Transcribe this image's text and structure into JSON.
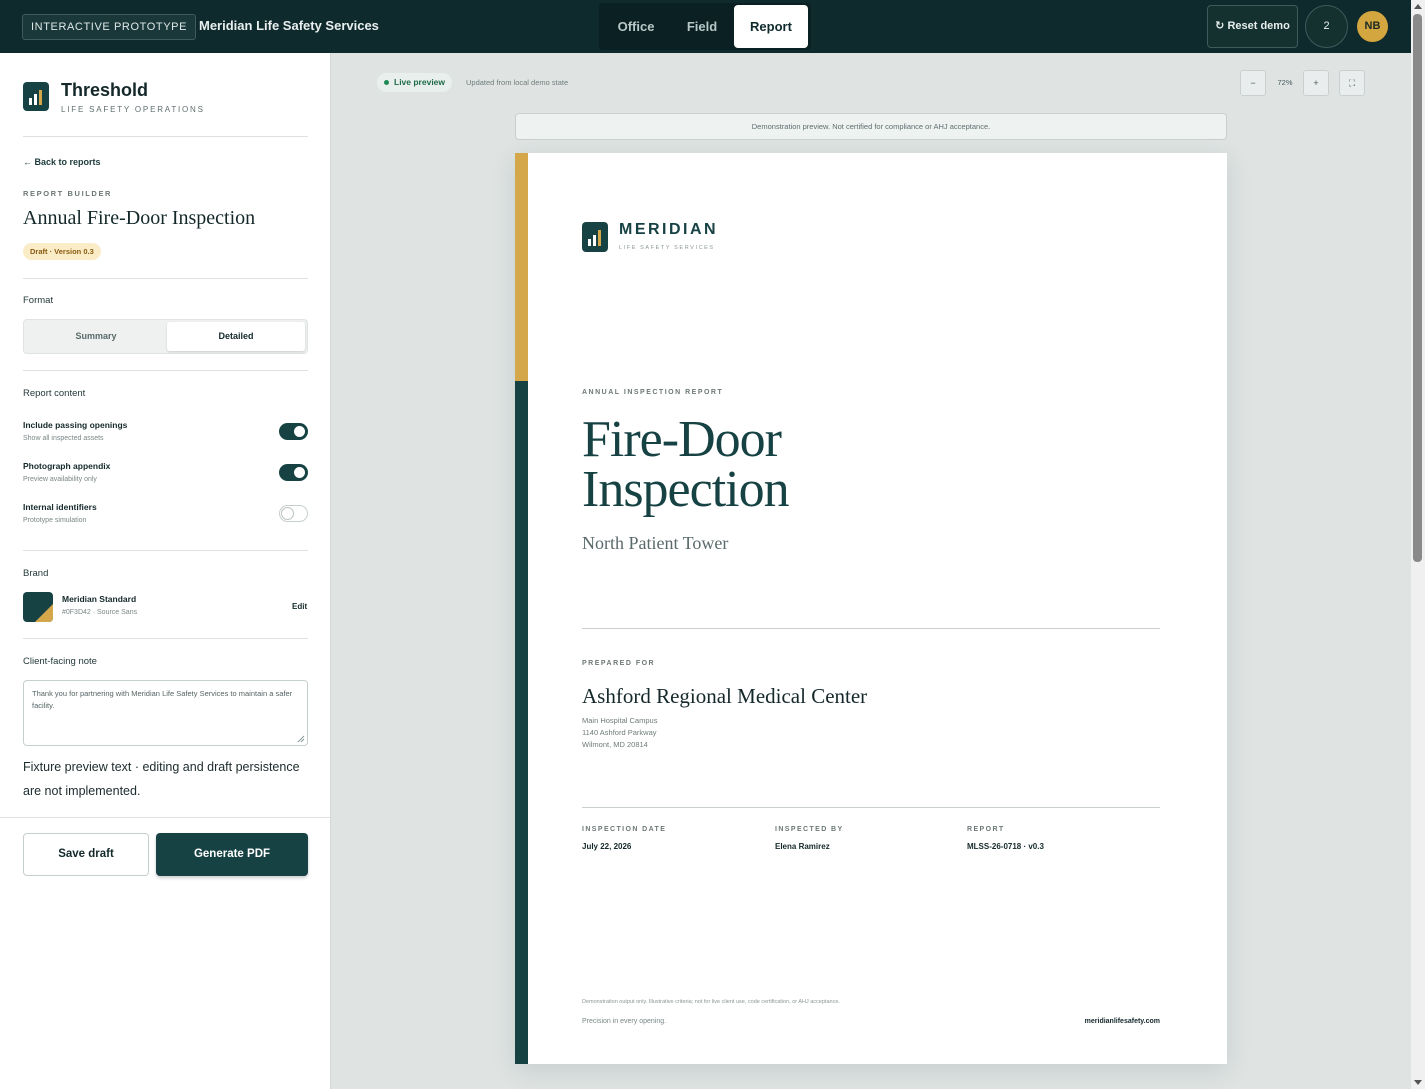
{
  "topbar": {
    "badge": "INTERACTIVE PROTOTYPE",
    "company": "Meridian Life Safety Services",
    "tabs": [
      {
        "label": "Office"
      },
      {
        "label": "Field"
      },
      {
        "label": "Report",
        "active": true
      }
    ],
    "reset_label": "↻ Reset demo",
    "count": "2",
    "avatar_initials": "NB"
  },
  "sidebar": {
    "app_name": "Threshold",
    "app_subtitle": "LIFE SAFETY OPERATIONS",
    "back_link": "← Back to reports",
    "eyebrow": "REPORT BUILDER",
    "report_title": "Annual Fire-Door Inspection",
    "status_pill": "Draft · Version 0.3",
    "format_label": "Format",
    "format_options": [
      {
        "label": "Summary",
        "active": false
      },
      {
        "label": "Detailed",
        "active": true
      }
    ],
    "content_label": "Report content",
    "toggles": [
      {
        "title": "Include passing openings",
        "desc": "Show all inspected assets",
        "on": true
      },
      {
        "title": "Photograph appendix",
        "desc": "Preview availability only",
        "on": true
      },
      {
        "title": "Internal identifiers",
        "desc": "Prototype simulation",
        "on": false
      }
    ],
    "brand_label": "Brand",
    "brand_name": "Meridian Standard",
    "brand_meta": "#0F3D42 · Source Sans",
    "edit_label": "Edit",
    "note_label": "Client-facing note",
    "note_value": "Thank you for partnering with Meridian Life Safety Services to maintain a safer facility.",
    "fixture_text": "Fixture preview text · editing and draft persistence are not implemented.",
    "save_label": "Save draft",
    "generate_label": "Generate PDF"
  },
  "preview": {
    "live_label": "Live preview",
    "updated_text": "Updated from local demo state",
    "zoom_out": "−",
    "zoom_level": "72%",
    "zoom_in": "+",
    "fullscreen_icon": "⛶",
    "disclaimer": "Demonstration preview. Not certified for compliance or AHJ acceptance."
  },
  "document": {
    "brand": "MERIDIAN",
    "brand_sub": "LIFE SAFETY SERVICES",
    "eyebrow": "ANNUAL INSPECTION REPORT",
    "title_line1": "Fire-Door",
    "title_line2": "Inspection",
    "subtitle": "North Patient Tower",
    "prepared_for_label": "PREPARED FOR",
    "client_name": "Ashford Regional Medical Center",
    "address": [
      "Main Hospital Campus",
      "1140 Ashford Parkway",
      "Wilmont, MD 20814"
    ],
    "meta": [
      {
        "label": "INSPECTION DATE",
        "value": "July 22, 2026"
      },
      {
        "label": "INSPECTED BY",
        "value": "Elena Ramirez"
      },
      {
        "label": "REPORT",
        "value": "MLSS-26-0718 · v0.3"
      }
    ],
    "fine_print": "Demonstration output only. Illustrative criteria; not for live client use, code certification, or AHJ acceptance.",
    "tagline": "Precision in every opening.",
    "website": "meridianlifesafety.com"
  },
  "colors": {
    "primary": "#174244",
    "topbar": "#0f2a2c",
    "accent_gold": "#d4a74a"
  }
}
